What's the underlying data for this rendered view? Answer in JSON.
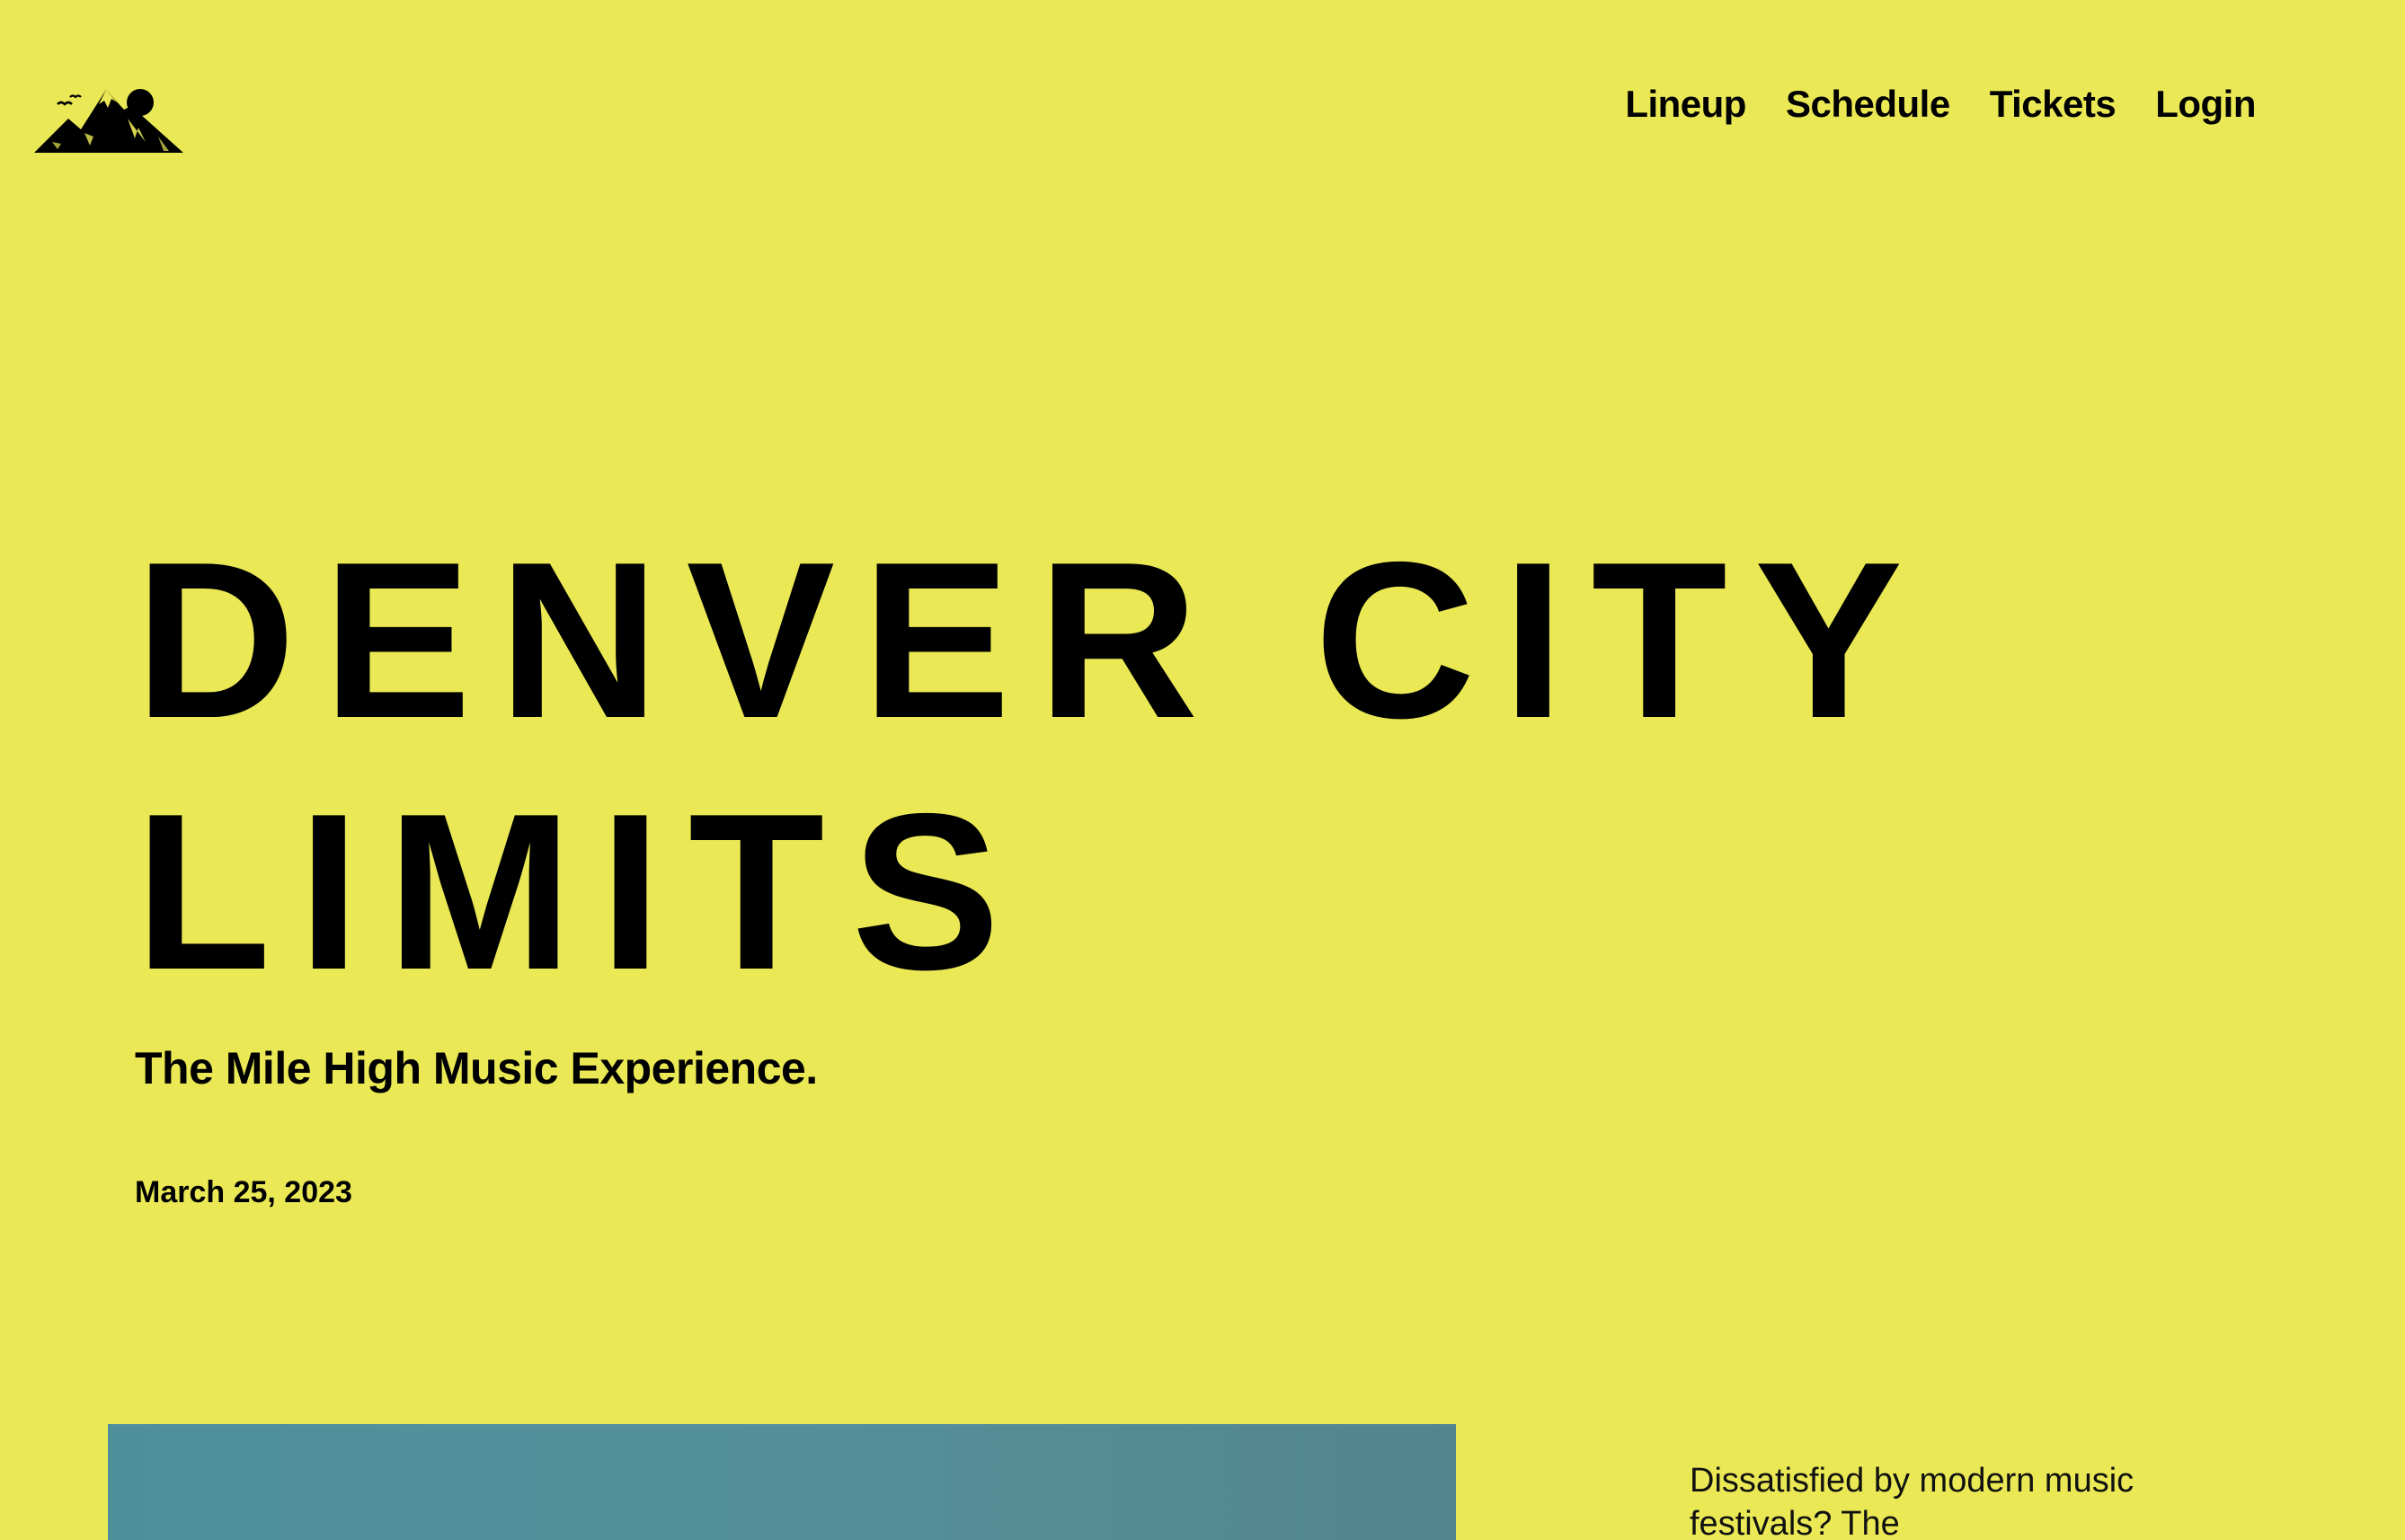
{
  "header": {
    "logo_icon": "mountain-sun-birds-logo",
    "nav": [
      {
        "label": "Lineup"
      },
      {
        "label": "Schedule"
      },
      {
        "label": "Tickets"
      },
      {
        "label": "Login"
      }
    ]
  },
  "hero": {
    "title_line1": "DENVER CITY",
    "title_line2": "LIMITS",
    "tagline": "The Mile High Music Experience.",
    "date": "March 25, 2023"
  },
  "intro": {
    "text": "Dissatisfied by modern music festivals? The"
  },
  "colors": {
    "background": "#EAE955",
    "text": "#000000",
    "image_teal": "#52909A"
  }
}
